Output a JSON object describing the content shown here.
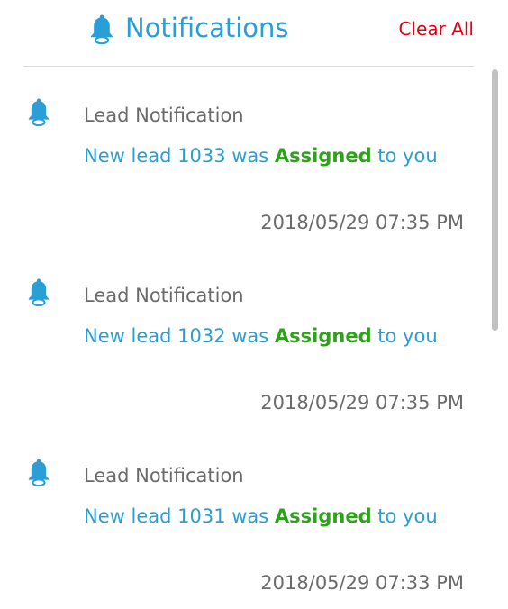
{
  "header": {
    "title": "Notifications",
    "clear_label": "Clear All",
    "icon": "bell-icon"
  },
  "colors": {
    "accent": "#2a9fd6",
    "danger": "#e60012",
    "success": "#2ea21b",
    "muted": "#6b6b6b"
  },
  "notifications": [
    {
      "title": "Lead Notification",
      "prefix": "New lead 1033 was ",
      "status": "Assigned",
      "suffix": " to you",
      "time": "2018/05/29 07:35 PM"
    },
    {
      "title": "Lead Notification",
      "prefix": "New lead 1032 was ",
      "status": "Assigned",
      "suffix": " to you",
      "time": "2018/05/29 07:35 PM"
    },
    {
      "title": "Lead Notification",
      "prefix": "New lead 1031 was ",
      "status": "Assigned",
      "suffix": " to you",
      "time": "2018/05/29 07:33 PM"
    }
  ]
}
